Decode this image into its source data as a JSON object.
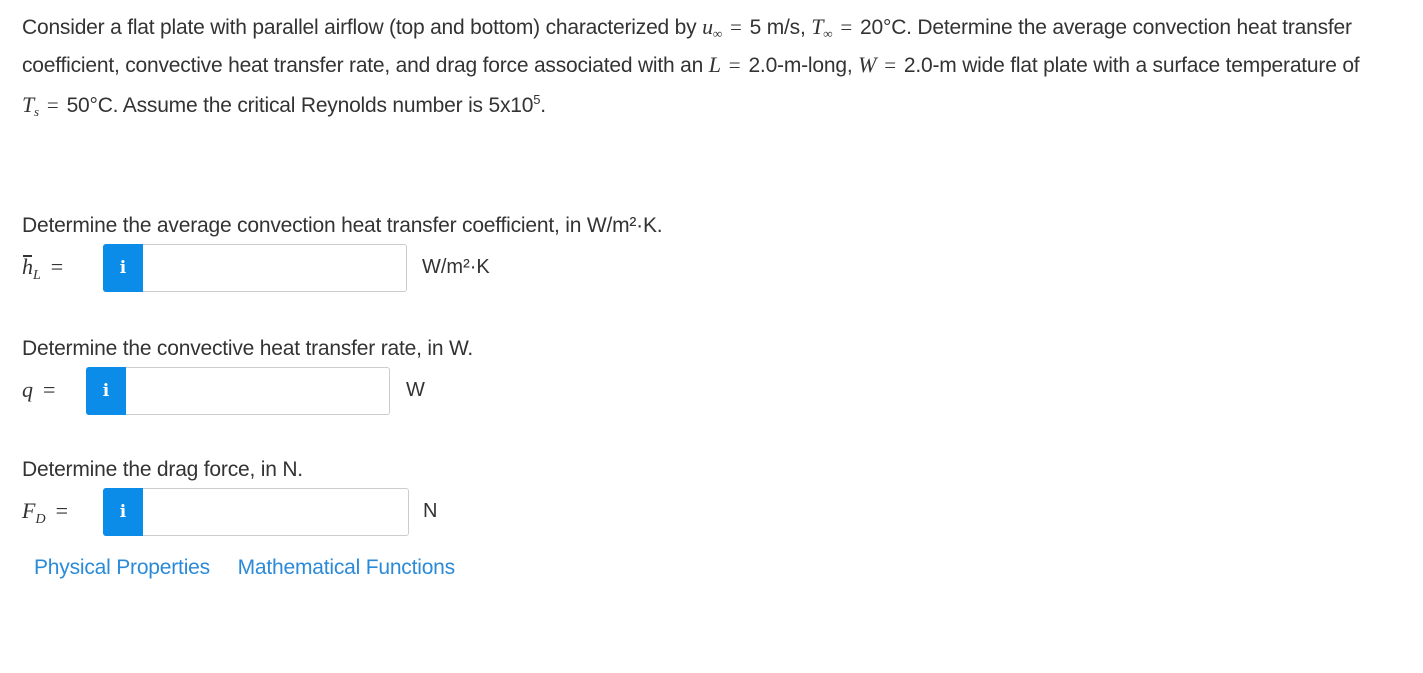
{
  "problem": {
    "p1": "Consider a flat plate with parallel airflow (top and bottom) characterized by ",
    "u_sym": "u",
    "inf_sub": "∞",
    "eq": "=",
    "u_val": "5 m/s, ",
    "t_sym": "T",
    "t_val": "20°C. Determine the average convection heat transfer coefficient, convective heat transfer rate, and drag force associated with an ",
    "l_sym": "L",
    "l_val": "2.0-m-long, ",
    "w_sym": "W",
    "w_val": "2.0-m wide flat plate with a surface temperature of ",
    "ts_sym": "T",
    "ts_sub": "s",
    "ts_val": "50°C. Assume the critical Reynolds number is 5x10",
    "re_exp": "5",
    "end": "."
  },
  "parts": [
    {
      "question": "Determine the average convection heat transfer coefficient, in W/m²·K.",
      "var": "h",
      "sub": "L",
      "eq": "=",
      "info_icon": "i",
      "value": "",
      "unit": "W/m²·K"
    },
    {
      "question": "Determine the convective heat transfer rate, in W.",
      "var": "q",
      "sub": "",
      "eq": "=",
      "info_icon": "i",
      "value": "",
      "unit": "W"
    },
    {
      "question": "Determine the drag force, in N.",
      "var": "F",
      "sub": "D",
      "eq": "=",
      "info_icon": "i",
      "value": "",
      "unit": "N"
    }
  ],
  "links": {
    "physical": "Physical Properties",
    "math": "Mathematical Functions"
  },
  "colors": {
    "accent": "#0c8ce9",
    "link": "#2b8ad8",
    "text": "#333333"
  }
}
